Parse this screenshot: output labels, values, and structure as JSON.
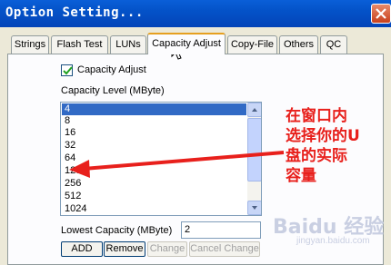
{
  "window": {
    "title": "Option Setting..."
  },
  "tabs": [
    {
      "label": "Strings"
    },
    {
      "label": "Flash Test"
    },
    {
      "label": "LUNs"
    },
    {
      "label": "Capacity Adjust"
    },
    {
      "label": "Copy-File"
    },
    {
      "label": "Others"
    },
    {
      "label": "QC"
    }
  ],
  "active_tab": "Capacity Adjust",
  "capacity": {
    "checkbox_label": "Capacity Adjust",
    "checked": true,
    "level_label": "Capacity Level (MByte)",
    "list_items": [
      "4",
      "8",
      "16",
      "32",
      "64",
      "128",
      "256",
      "512",
      "1024"
    ],
    "selected_item": "4",
    "lowest_label": "Lowest Capacity (MByte)",
    "lowest_value": "2"
  },
  "buttons": {
    "add": "ADD",
    "remove": "Remove",
    "change": "Change",
    "cancel_change": "Cancel Change"
  },
  "annotation": {
    "lines": [
      "在窗口内",
      "选择你的U",
      "盘的实际",
      "容量"
    ],
    "color": "#e8201c"
  },
  "watermark": {
    "logo": "Baidu 经验",
    "url": "jingyan.baidu.com"
  }
}
